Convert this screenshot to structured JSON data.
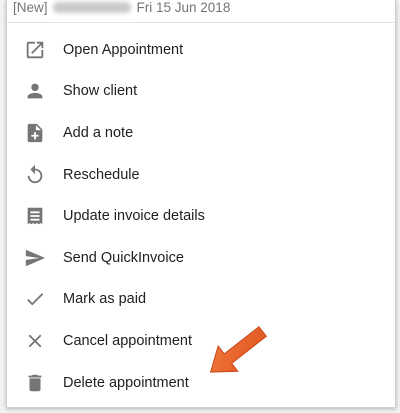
{
  "header": {
    "prefix": "[New]",
    "date": "Fri 15 Jun 2018"
  },
  "menu": {
    "items": [
      {
        "label": "Open Appointment",
        "icon": "open-in-new-icon"
      },
      {
        "label": "Show client",
        "icon": "person-icon"
      },
      {
        "label": "Add a note",
        "icon": "note-add-icon"
      },
      {
        "label": "Reschedule",
        "icon": "reschedule-icon"
      },
      {
        "label": "Update invoice details",
        "icon": "receipt-icon"
      },
      {
        "label": "Send QuickInvoice",
        "icon": "send-icon"
      },
      {
        "label": "Mark as paid",
        "icon": "check-icon"
      },
      {
        "label": "Cancel appointment",
        "icon": "close-icon"
      },
      {
        "label": "Delete appointment",
        "icon": "trash-icon"
      }
    ]
  },
  "colors": {
    "icon": "#757575",
    "text": "#212121",
    "arrow": "#e8622b"
  }
}
